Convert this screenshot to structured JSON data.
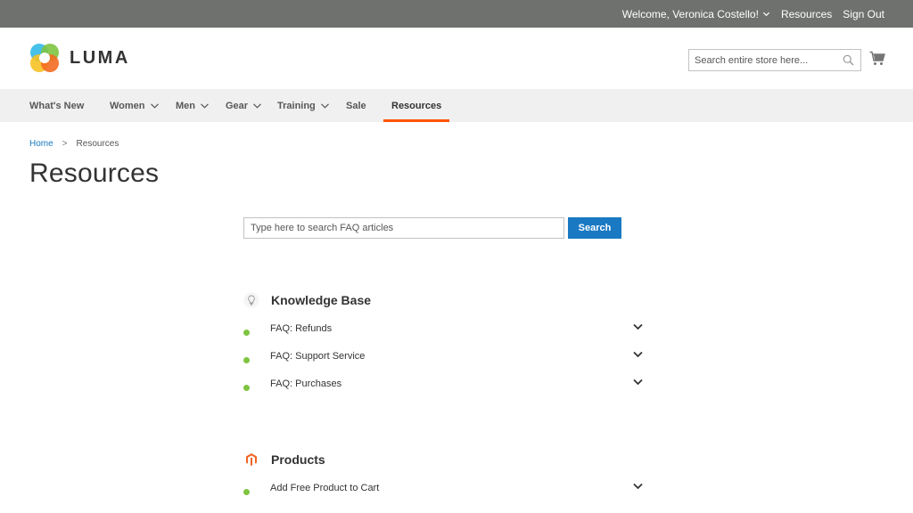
{
  "topbar": {
    "welcome": "Welcome, Veronica Costello!",
    "links": [
      "Resources",
      "Sign Out"
    ]
  },
  "header": {
    "logo_text": "LUMA",
    "search_placeholder": "Search entire store here...",
    "cart_icon": "cart-icon"
  },
  "nav": {
    "items": [
      {
        "label": "What's New",
        "dropdown": false
      },
      {
        "label": "Women",
        "dropdown": true
      },
      {
        "label": "Men",
        "dropdown": true
      },
      {
        "label": "Gear",
        "dropdown": true
      },
      {
        "label": "Training",
        "dropdown": true
      },
      {
        "label": "Sale",
        "dropdown": false
      },
      {
        "label": "Resources",
        "dropdown": false,
        "active": true
      }
    ]
  },
  "breadcrumb": {
    "home": "Home",
    "separator": ">",
    "current": "Resources"
  },
  "page": {
    "title": "Resources"
  },
  "faq_search": {
    "placeholder": "Type here to search FAQ articles",
    "button": "Search"
  },
  "sections": [
    {
      "title": "Knowledge Base",
      "icon": "lightbulb-icon",
      "items": [
        "FAQ: Refunds",
        "FAQ: Support Service",
        "FAQ: Purchases"
      ]
    },
    {
      "title": "Products",
      "icon": "magento-logo-icon",
      "items": [
        "Add Free Product to Cart"
      ]
    }
  ],
  "colors": {
    "topbar": "#6e716e",
    "nav_bg": "#f0f0f0",
    "accent": "#ff5501",
    "link": "#1979c3",
    "bullet": "#7ec440"
  }
}
